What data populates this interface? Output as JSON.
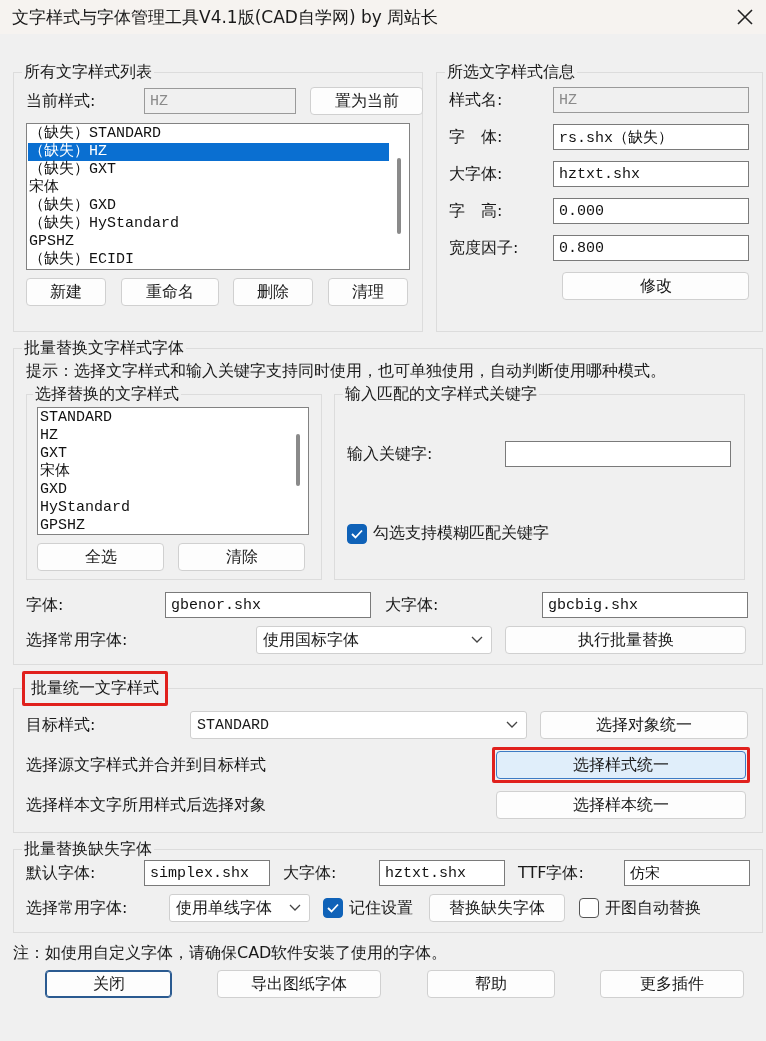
{
  "window": {
    "title": "文字样式与字体管理工具V4.1版(CAD自学网) by 周站长"
  },
  "style_list": {
    "title": "所有文字样式列表",
    "current_label": "当前样式:",
    "current_value": "HZ",
    "set_current_button": "置为当前",
    "items": [
      {
        "label": "（缺失）STANDARD",
        "selected": false
      },
      {
        "label": "（缺失）HZ",
        "selected": true
      },
      {
        "label": "（缺失）GXT",
        "selected": false
      },
      {
        "label": "宋体",
        "selected": false
      },
      {
        "label": "（缺失）GXD",
        "selected": false
      },
      {
        "label": "（缺失）HyStandard",
        "selected": false
      },
      {
        "label": "GPSHZ",
        "selected": false
      },
      {
        "label": "（缺失）ECIDI",
        "selected": false
      }
    ],
    "buttons": [
      "新建",
      "重命名",
      "删除",
      "清理"
    ]
  },
  "style_info": {
    "title": "所选文字样式信息",
    "fields": [
      {
        "label": "样式名:",
        "value": "HZ",
        "disabled": true
      },
      {
        "label": "字　体:",
        "value": "rs.shx（缺失）",
        "disabled": false
      },
      {
        "label": "大字体:",
        "value": "hztxt.shx",
        "disabled": false
      },
      {
        "label": "字　高:",
        "value": "0.000",
        "disabled": false
      },
      {
        "label": "宽度因子:",
        "value": "0.800",
        "disabled": false
      }
    ],
    "button": "修改"
  },
  "batch_replace": {
    "title": "批量替换文字样式字体",
    "hint": "提示：选择文字样式和输入关键字支持同时使用，也可单独使用，自动判断使用哪种模式。",
    "style_select": {
      "title": "选择替换的文字样式",
      "items": [
        "STANDARD",
        "HZ",
        "GXT",
        "宋体",
        "GXD",
        "HyStandard",
        "GPSHZ"
      ],
      "buttons": [
        "全选",
        "清除"
      ]
    },
    "keyword": {
      "title": "输入匹配的文字样式关键字",
      "label": "输入关键字:",
      "fuzzy": {
        "label": "勾选支持模糊匹配关键字",
        "checked": true
      }
    },
    "font_label": "字体:",
    "font_value": "gbenor.shx",
    "bigfont_label": "大字体:",
    "bigfont_value": "gbcbig.shx",
    "common_label": "选择常用字体:",
    "common_value": "使用国标字体",
    "execute_button": "执行批量替换"
  },
  "unify": {
    "title": "批量统一文字样式",
    "highlighted": true,
    "rows": [
      {
        "kind": "dropdown",
        "label": "目标样式:",
        "value": "STANDARD",
        "button": "选择对象统一",
        "highlighted": false
      },
      {
        "kind": "text",
        "label": "选择源文字样式并合并到目标样式",
        "button": "选择样式统一",
        "highlighted": true
      },
      {
        "kind": "text",
        "label": "选择样本文字所用样式后选择对象",
        "button": "选择样本统一",
        "highlighted": false
      }
    ]
  },
  "missing_fonts": {
    "title": "批量替换缺失字体",
    "default_label": "默认字体:",
    "default_value": "simplex.shx",
    "bigfont_label": "大字体:",
    "bigfont_value": "hztxt.shx",
    "ttf_label": "TTF字体:",
    "ttf_value": "仿宋",
    "common_label": "选择常用字体:",
    "common_value": "使用单线字体",
    "remember": {
      "label": "记住设置",
      "checked": true
    },
    "replace_button": "替换缺失字体",
    "auto": {
      "label": "开图自动替换",
      "checked": false
    }
  },
  "note": "注：如使用自定义字体，请确保CAD软件安装了使用的字体。",
  "footer_buttons": [
    {
      "label": "关闭",
      "focused": true
    },
    {
      "label": "导出图纸字体",
      "focused": false
    },
    {
      "label": "帮助",
      "focused": false
    },
    {
      "label": "更多插件",
      "focused": false
    }
  ]
}
